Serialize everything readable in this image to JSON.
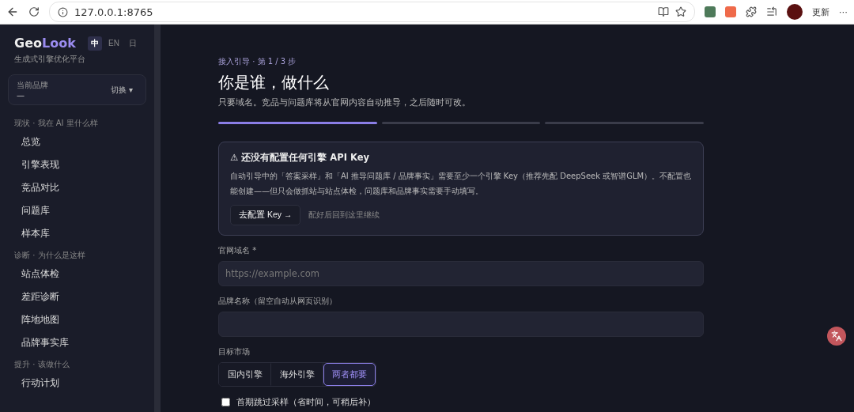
{
  "browser": {
    "url": "127.0.0.1:8765",
    "update_label": "更新",
    "more_label": "⋯"
  },
  "sidebar": {
    "logo_primary": "Geo",
    "logo_accent": "Look",
    "tagline": "生成式引擎优化平台",
    "languages": [
      {
        "label": "中",
        "selected": true
      },
      {
        "label": "EN",
        "selected": false
      },
      {
        "label": "日",
        "selected": false
      }
    ],
    "brand_card": {
      "caption": "当前品牌",
      "value": "—",
      "switch_label": "切换",
      "switch_caret": "▾"
    },
    "sections": [
      {
        "title": "现状 · 我在 AI 里什么样",
        "items": [
          {
            "label": "总览"
          },
          {
            "label": "引擎表现"
          },
          {
            "label": "竞品对比"
          },
          {
            "label": "问题库"
          },
          {
            "label": "样本库"
          }
        ]
      },
      {
        "title": "诊断 · 为什么是这样",
        "items": [
          {
            "label": "站点体检"
          },
          {
            "label": "差距诊断"
          },
          {
            "label": "阵地地图"
          },
          {
            "label": "品牌事实库"
          }
        ]
      },
      {
        "title": "提升 · 该做什么",
        "items": [
          {
            "label": "行动计划"
          }
        ]
      }
    ]
  },
  "main": {
    "breadcrumb": "接入引导 · 第 1 / 3 步",
    "title": "你是谁，做什么",
    "subtitle": "只要域名。竞品与问题库将从官网内容自动推导，之后随时可改。",
    "steps": [
      {
        "done": true
      },
      {
        "done": false
      },
      {
        "done": false
      }
    ],
    "alert": {
      "title": "⚠ 还没有配置任何引擎 API Key",
      "body": "自动引导中的「答案采样」和「AI 推导问题库 / 品牌事实」需要至少一个引擎 Key（推荐先配 DeepSeek 或智谱GLM）。不配置也能创建——但只会做抓站与站点体检，问题库和品牌事实需要手动填写。",
      "button": "去配置 Key →",
      "hint": "配好后回到这里继续"
    },
    "fields": [
      {
        "label": "官网域名 *",
        "placeholder": "https://example.com"
      },
      {
        "label": "品牌名称（留空自动从网页识别）"
      }
    ],
    "market": {
      "label": "目标市场",
      "options": [
        {
          "label": "国内引擎",
          "selected": false
        },
        {
          "label": "海外引擎",
          "selected": false
        },
        {
          "label": "两者都要",
          "selected": true
        }
      ]
    },
    "skip_sampling": {
      "label": "首期跳过采样（省时间，可稍后补）",
      "checked": false
    }
  }
}
